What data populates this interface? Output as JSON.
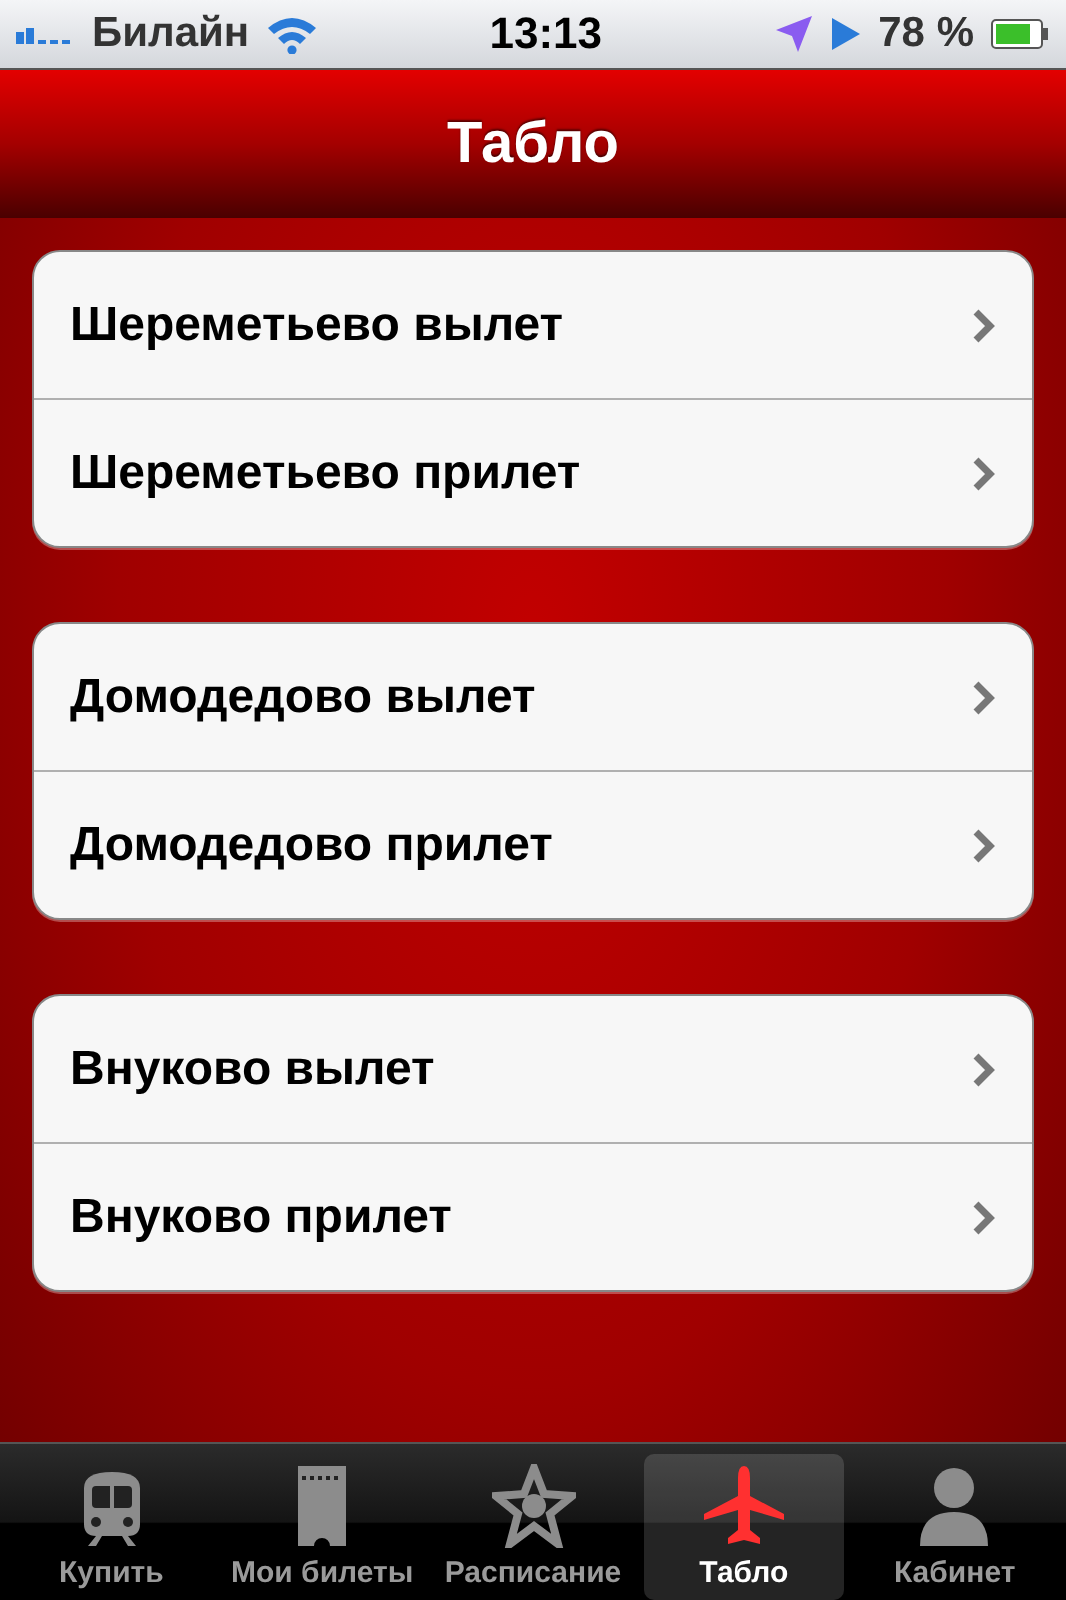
{
  "status_bar": {
    "carrier": "Билайн",
    "time": "13:13",
    "battery": "78 %"
  },
  "nav_bar": {
    "title": "Табло"
  },
  "groups": [
    {
      "rows": [
        {
          "label": "Шереметьево вылет"
        },
        {
          "label": "Шереметьево прилет"
        }
      ]
    },
    {
      "rows": [
        {
          "label": "Домодедово вылет"
        },
        {
          "label": "Домодедово прилет"
        }
      ]
    },
    {
      "rows": [
        {
          "label": "Внуково вылет"
        },
        {
          "label": "Внуково прилет"
        }
      ]
    }
  ],
  "tab_bar": [
    {
      "label": "Купить",
      "kind": "train",
      "selected": false
    },
    {
      "label": "Мои билеты",
      "kind": "ticket",
      "selected": false
    },
    {
      "label": "Расписание",
      "kind": "star",
      "selected": false
    },
    {
      "label": "Табло",
      "kind": "plane",
      "selected": true
    },
    {
      "label": "Кабинет",
      "kind": "person",
      "selected": false
    }
  ]
}
